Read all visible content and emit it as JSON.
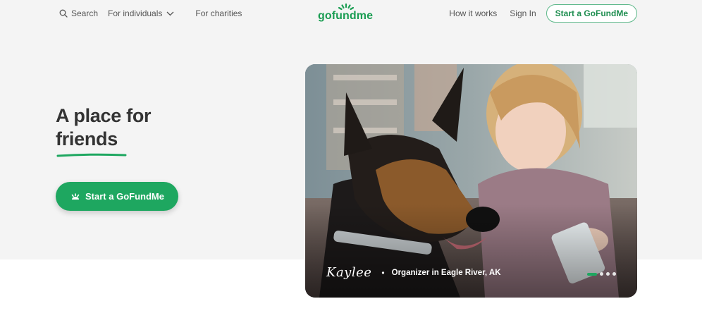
{
  "header": {
    "search_label": "Search",
    "individuals_label": "For individuals",
    "charities_label": "For charities",
    "logo_text": "gofundme",
    "how_label": "How it works",
    "signin_label": "Sign In",
    "start_label": "Start a GoFundMe"
  },
  "hero": {
    "title_line1": "A place for",
    "title_line2": "friends",
    "cta_label": "Start a GoFundMe"
  },
  "feature": {
    "name": "Kaylee",
    "separator": "•",
    "role": "Organizer in Eagle River, AK",
    "carousel_count": 4,
    "carousel_active_index": 0
  },
  "colors": {
    "brand_green": "#1ea760",
    "hero_background": "#f4f4f4",
    "text_dark": "#333333"
  },
  "icons": {
    "search": "search-icon",
    "dropdown": "chevron-down-icon",
    "logo_sun": "sun-rays-icon",
    "cta": "sun-icon"
  }
}
